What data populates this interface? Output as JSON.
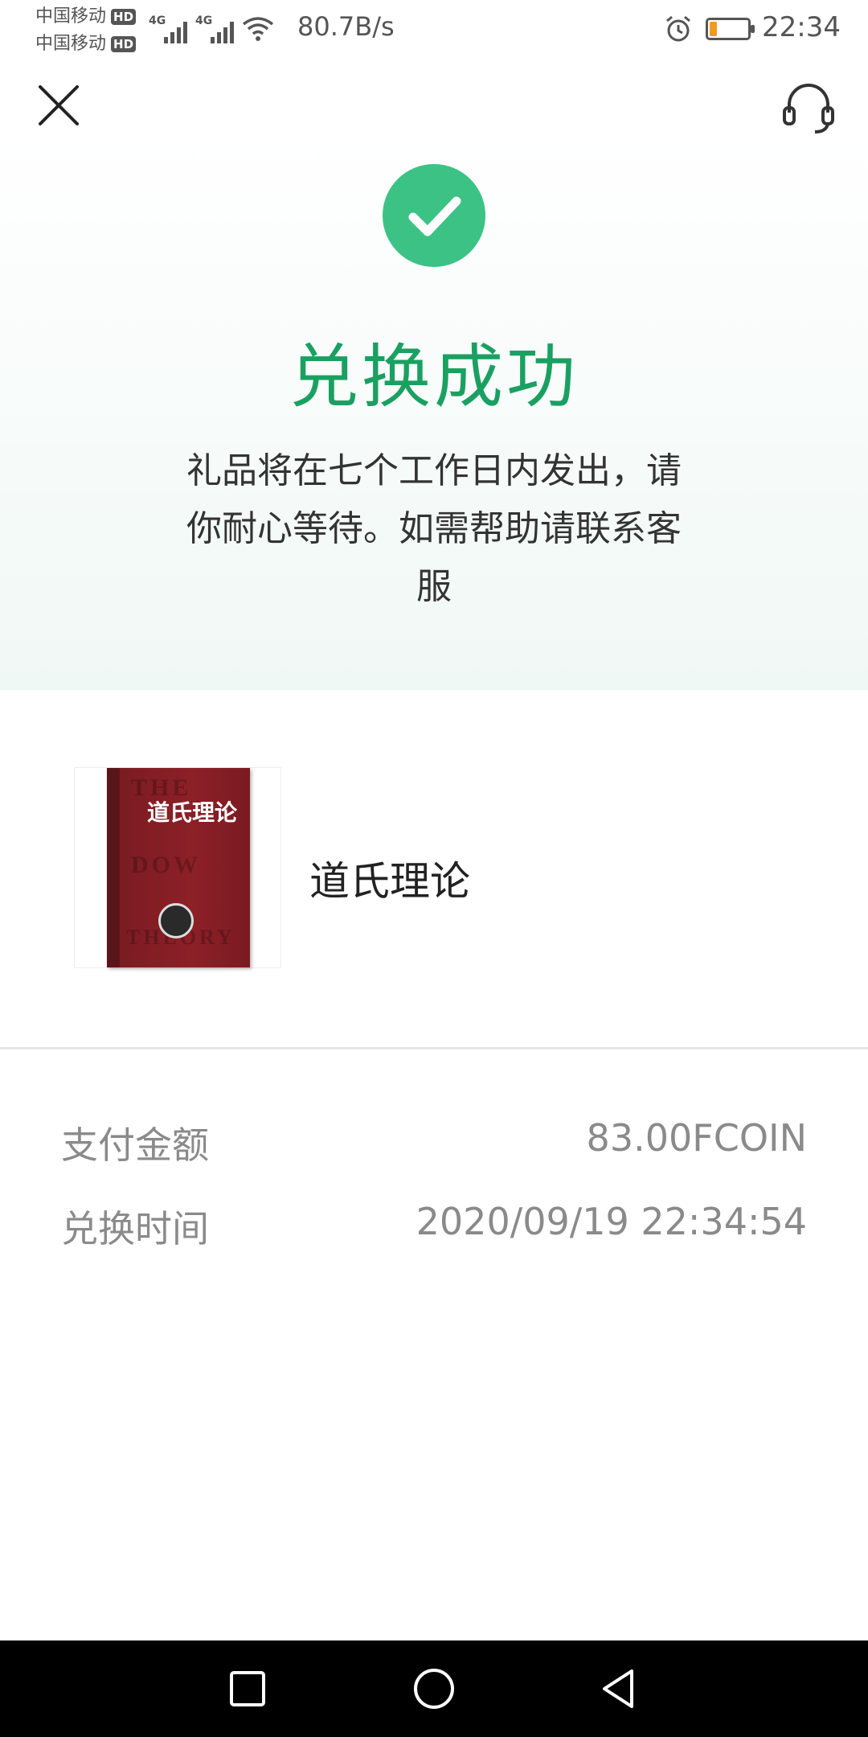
{
  "status_bar": {
    "carrier1": "中国移动",
    "carrier2": "中国移动",
    "hd_badge": "HD",
    "network_type": "4G",
    "net_speed": "80.7B/s",
    "time": "22:34",
    "battery_level": 0.2,
    "battery_color": "#f29a1f"
  },
  "header": {
    "close_icon": "close-icon",
    "support_icon": "headset-icon"
  },
  "result": {
    "icon": "check-circle-icon",
    "title": "兑换成功",
    "description": "礼品将在七个工作日内发出，请你耐心等待。如需帮助请联系客服",
    "accent_color": "#1aa061",
    "check_color": "#3cc285"
  },
  "product": {
    "image_title": "道氏理论",
    "name": "道氏理论"
  },
  "details": {
    "amount_label": "支付金额",
    "amount_value": "83.00FCOIN",
    "time_label": "兑换时间",
    "time_value": "2020/09/19 22:34:54"
  },
  "nav": {
    "recent_icon": "square-icon",
    "home_icon": "circle-icon",
    "back_icon": "triangle-back-icon"
  }
}
